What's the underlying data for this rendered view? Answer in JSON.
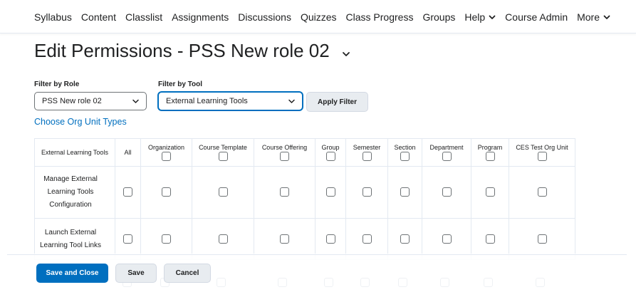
{
  "nav": {
    "items": [
      {
        "label": "Syllabus"
      },
      {
        "label": "Content"
      },
      {
        "label": "Classlist"
      },
      {
        "label": "Assignments"
      },
      {
        "label": "Discussions"
      },
      {
        "label": "Quizzes"
      },
      {
        "label": "Class Progress"
      },
      {
        "label": "Groups"
      },
      {
        "label": "Help",
        "has_menu": true
      },
      {
        "label": "Course Admin"
      },
      {
        "label": "More",
        "has_menu": true
      }
    ]
  },
  "page": {
    "title": "Edit Permissions - PSS New role 02"
  },
  "filters": {
    "role_label": "Filter by Role",
    "role_value": "PSS New role 02",
    "tool_label": "Filter by Tool",
    "tool_value": "External Learning Tools",
    "apply_label": "Apply Filter"
  },
  "org_unit_link": "Choose Org Unit Types",
  "table": {
    "tool_header": "External Learning Tools",
    "all_header": "All",
    "columns": [
      "Organization",
      "Course Template",
      "Course Offering",
      "Group",
      "Semester",
      "Section",
      "Department",
      "Program",
      "CES Test Org Unit"
    ],
    "rows": [
      {
        "label_lines": [
          "Manage External",
          "Learning Tools",
          "Configuration"
        ]
      },
      {
        "label_lines": [
          "Launch External",
          "Learning Tool Links"
        ]
      }
    ]
  },
  "actions": {
    "save_close": "Save and Close",
    "save": "Save",
    "cancel": "Cancel"
  },
  "colors": {
    "primary": "#006fbf",
    "link": "#006fbf",
    "border": "#e3e9f1",
    "text": "#202122"
  },
  "icons": {
    "menu_chevron": "chevron-down-icon",
    "select_chevron": "chevron-down-icon"
  }
}
